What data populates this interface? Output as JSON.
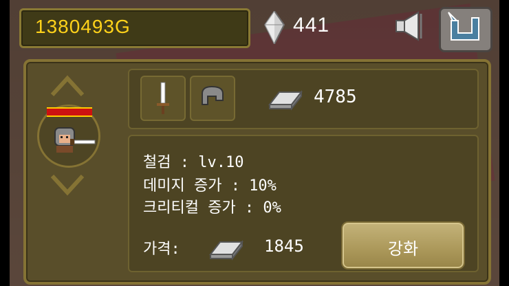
{
  "hud": {
    "gold": "1380493G",
    "gems": "441"
  },
  "items": {
    "ingot_count": "4785"
  },
  "stats": {
    "line1": "철검 : lv.10",
    "line2": "데미지 증가 : 10%",
    "line3": "크리티컬 증가 : 0%"
  },
  "price": {
    "label": "가격:",
    "value": "1845"
  },
  "buttons": {
    "upgrade": "강화"
  },
  "colors": {
    "gold_text": "#ffd21a",
    "panel_bg": "#4d4423",
    "panel_border": "#857334",
    "hp_bar": "#cc1111"
  },
  "icons": {
    "gem": "crystal-icon",
    "sound": "speaker-muted-icon",
    "back": "return-arrow-icon",
    "up": "chevron-up-icon",
    "down": "chevron-down-icon",
    "slot1": "sword-icon",
    "slot2": "helmet-icon",
    "ingot": "ingot-icon"
  }
}
